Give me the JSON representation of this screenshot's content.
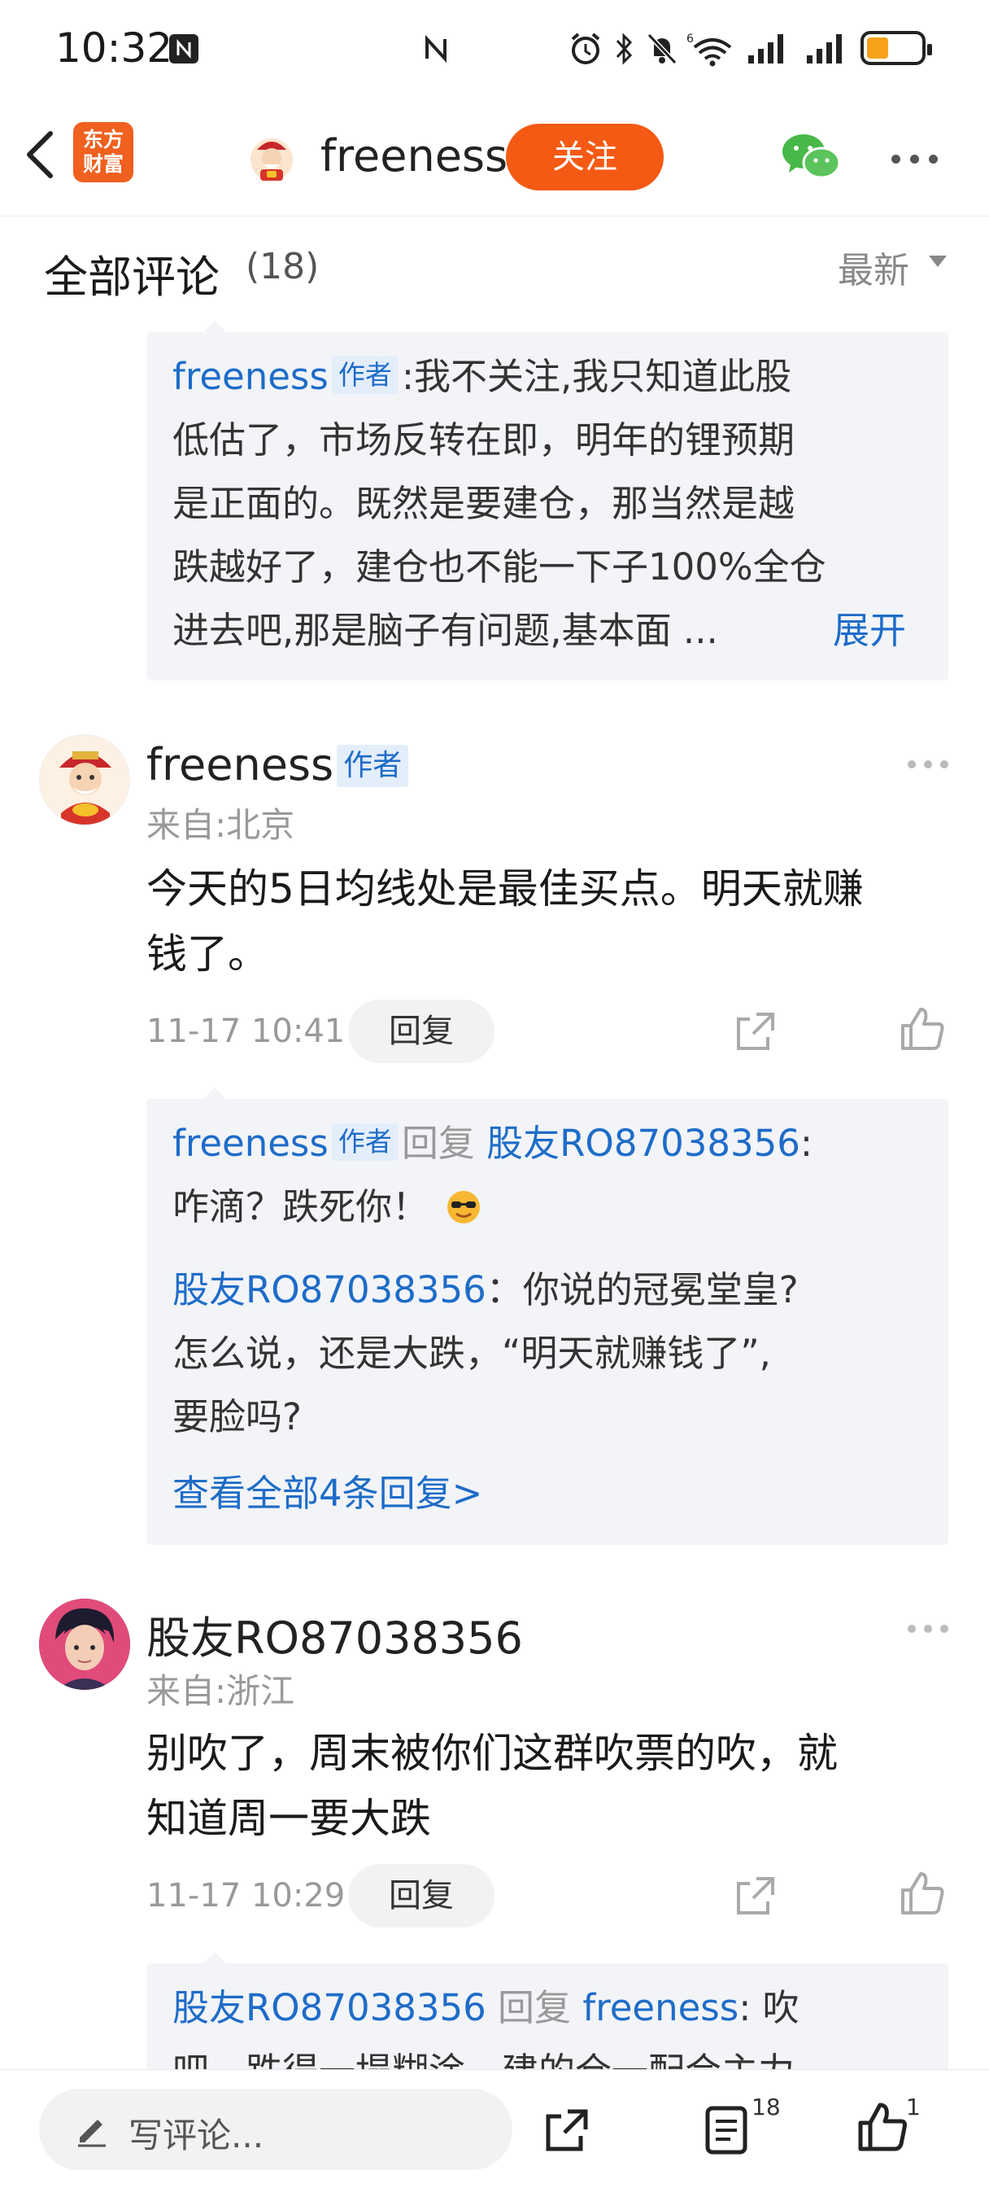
{
  "status_bar": {
    "time": "10:32",
    "icons": [
      "nfc-icon",
      "alarm-icon",
      "bluetooth-icon",
      "mute-icon",
      "wifi-icon",
      "signal-icon",
      "signal-icon",
      "battery-icon"
    ],
    "battery_level": 0.3
  },
  "nav": {
    "logo_line1": "东方",
    "logo_line2": "财富",
    "title": "freeness",
    "follow_label": "关注"
  },
  "comments_header": {
    "title": "全部评论",
    "count": "(18)",
    "sort_label": "最新"
  },
  "top_reply": {
    "author": "freeness",
    "author_tag": "作者",
    "lines": [
      ":我不关注,我只知道此股",
      "低估了，市场反转在即，明年的锂预期",
      "是正面的。既然是要建仓，那当然是越",
      "跌越好了，建仓也不能一下子100%全仓",
      "进去吧,那是脑子有问题,基本面 ..."
    ],
    "expand_label": "展开"
  },
  "comments": [
    {
      "name": "freeness",
      "tag": "作者",
      "location": "来自:北京",
      "body_lines": [
        "今天的5日均线处是最佳买点。明天就赚",
        "钱了。"
      ],
      "time": "11-17 10:41",
      "reply_label": "回复",
      "replies": [
        {
          "author": "freeness",
          "author_tag": "作者",
          "reply_word": "回复",
          "target": "股友RO87038356",
          "text_line1": ":",
          "text_line2": "咋滴？跌死你！"
        },
        {
          "author": "股友RO87038356",
          "text_line1": "：你说的冠冕堂皇?",
          "text_line2": "怎么说，还是大跌，“明天就赚钱了”,",
          "text_line3": "要脸吗?"
        }
      ],
      "view_all": "查看全部4条回复>"
    },
    {
      "name": "股友RO87038356",
      "location": "来自:浙江",
      "body_lines": [
        "别吹了，周末被你们这群吹票的吹，就",
        "知道周一要大跌"
      ],
      "time": "11-17 10:29",
      "reply_label": "回复",
      "replies": [
        {
          "author": "股友RO87038356",
          "reply_word": "回复",
          "target": "freeness",
          "text_line1": ": 吹",
          "text_line2": "吧，跌得一塌糊涂，建的仓一配合主力"
        }
      ]
    }
  ],
  "bottom_bar": {
    "write_placeholder": "写评论...",
    "comment_count": "18",
    "like_count": "1"
  },
  "colors": {
    "accent": "#f55a14",
    "link_blue": "#1e6cc8",
    "reply_bg": "#f2f4f7"
  }
}
